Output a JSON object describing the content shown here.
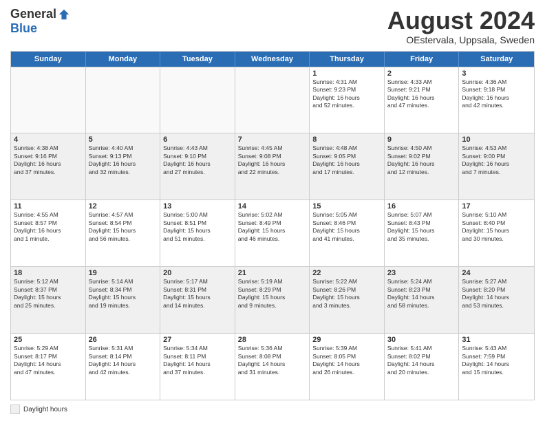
{
  "logo": {
    "general": "General",
    "blue": "Blue"
  },
  "title": "August 2024",
  "location": "OEstervala, Uppsala, Sweden",
  "days_of_week": [
    "Sunday",
    "Monday",
    "Tuesday",
    "Wednesday",
    "Thursday",
    "Friday",
    "Saturday"
  ],
  "weeks": [
    [
      {
        "num": "",
        "info": "",
        "empty": true
      },
      {
        "num": "",
        "info": "",
        "empty": true
      },
      {
        "num": "",
        "info": "",
        "empty": true
      },
      {
        "num": "",
        "info": "",
        "empty": true
      },
      {
        "num": "1",
        "info": "Sunrise: 4:31 AM\nSunset: 9:23 PM\nDaylight: 16 hours\nand 52 minutes.",
        "empty": false
      },
      {
        "num": "2",
        "info": "Sunrise: 4:33 AM\nSunset: 9:21 PM\nDaylight: 16 hours\nand 47 minutes.",
        "empty": false
      },
      {
        "num": "3",
        "info": "Sunrise: 4:36 AM\nSunset: 9:18 PM\nDaylight: 16 hours\nand 42 minutes.",
        "empty": false
      }
    ],
    [
      {
        "num": "4",
        "info": "Sunrise: 4:38 AM\nSunset: 9:16 PM\nDaylight: 16 hours\nand 37 minutes.",
        "empty": false
      },
      {
        "num": "5",
        "info": "Sunrise: 4:40 AM\nSunset: 9:13 PM\nDaylight: 16 hours\nand 32 minutes.",
        "empty": false
      },
      {
        "num": "6",
        "info": "Sunrise: 4:43 AM\nSunset: 9:10 PM\nDaylight: 16 hours\nand 27 minutes.",
        "empty": false
      },
      {
        "num": "7",
        "info": "Sunrise: 4:45 AM\nSunset: 9:08 PM\nDaylight: 16 hours\nand 22 minutes.",
        "empty": false
      },
      {
        "num": "8",
        "info": "Sunrise: 4:48 AM\nSunset: 9:05 PM\nDaylight: 16 hours\nand 17 minutes.",
        "empty": false
      },
      {
        "num": "9",
        "info": "Sunrise: 4:50 AM\nSunset: 9:02 PM\nDaylight: 16 hours\nand 12 minutes.",
        "empty": false
      },
      {
        "num": "10",
        "info": "Sunrise: 4:53 AM\nSunset: 9:00 PM\nDaylight: 16 hours\nand 7 minutes.",
        "empty": false
      }
    ],
    [
      {
        "num": "11",
        "info": "Sunrise: 4:55 AM\nSunset: 8:57 PM\nDaylight: 16 hours\nand 1 minute.",
        "empty": false
      },
      {
        "num": "12",
        "info": "Sunrise: 4:57 AM\nSunset: 8:54 PM\nDaylight: 15 hours\nand 56 minutes.",
        "empty": false
      },
      {
        "num": "13",
        "info": "Sunrise: 5:00 AM\nSunset: 8:51 PM\nDaylight: 15 hours\nand 51 minutes.",
        "empty": false
      },
      {
        "num": "14",
        "info": "Sunrise: 5:02 AM\nSunset: 8:49 PM\nDaylight: 15 hours\nand 46 minutes.",
        "empty": false
      },
      {
        "num": "15",
        "info": "Sunrise: 5:05 AM\nSunset: 8:46 PM\nDaylight: 15 hours\nand 41 minutes.",
        "empty": false
      },
      {
        "num": "16",
        "info": "Sunrise: 5:07 AM\nSunset: 8:43 PM\nDaylight: 15 hours\nand 35 minutes.",
        "empty": false
      },
      {
        "num": "17",
        "info": "Sunrise: 5:10 AM\nSunset: 8:40 PM\nDaylight: 15 hours\nand 30 minutes.",
        "empty": false
      }
    ],
    [
      {
        "num": "18",
        "info": "Sunrise: 5:12 AM\nSunset: 8:37 PM\nDaylight: 15 hours\nand 25 minutes.",
        "empty": false
      },
      {
        "num": "19",
        "info": "Sunrise: 5:14 AM\nSunset: 8:34 PM\nDaylight: 15 hours\nand 19 minutes.",
        "empty": false
      },
      {
        "num": "20",
        "info": "Sunrise: 5:17 AM\nSunset: 8:31 PM\nDaylight: 15 hours\nand 14 minutes.",
        "empty": false
      },
      {
        "num": "21",
        "info": "Sunrise: 5:19 AM\nSunset: 8:29 PM\nDaylight: 15 hours\nand 9 minutes.",
        "empty": false
      },
      {
        "num": "22",
        "info": "Sunrise: 5:22 AM\nSunset: 8:26 PM\nDaylight: 15 hours\nand 3 minutes.",
        "empty": false
      },
      {
        "num": "23",
        "info": "Sunrise: 5:24 AM\nSunset: 8:23 PM\nDaylight: 14 hours\nand 58 minutes.",
        "empty": false
      },
      {
        "num": "24",
        "info": "Sunrise: 5:27 AM\nSunset: 8:20 PM\nDaylight: 14 hours\nand 53 minutes.",
        "empty": false
      }
    ],
    [
      {
        "num": "25",
        "info": "Sunrise: 5:29 AM\nSunset: 8:17 PM\nDaylight: 14 hours\nand 47 minutes.",
        "empty": false
      },
      {
        "num": "26",
        "info": "Sunrise: 5:31 AM\nSunset: 8:14 PM\nDaylight: 14 hours\nand 42 minutes.",
        "empty": false
      },
      {
        "num": "27",
        "info": "Sunrise: 5:34 AM\nSunset: 8:11 PM\nDaylight: 14 hours\nand 37 minutes.",
        "empty": false
      },
      {
        "num": "28",
        "info": "Sunrise: 5:36 AM\nSunset: 8:08 PM\nDaylight: 14 hours\nand 31 minutes.",
        "empty": false
      },
      {
        "num": "29",
        "info": "Sunrise: 5:39 AM\nSunset: 8:05 PM\nDaylight: 14 hours\nand 26 minutes.",
        "empty": false
      },
      {
        "num": "30",
        "info": "Sunrise: 5:41 AM\nSunset: 8:02 PM\nDaylight: 14 hours\nand 20 minutes.",
        "empty": false
      },
      {
        "num": "31",
        "info": "Sunrise: 5:43 AM\nSunset: 7:59 PM\nDaylight: 14 hours\nand 15 minutes.",
        "empty": false
      }
    ]
  ],
  "footer": {
    "label": "Daylight hours"
  }
}
